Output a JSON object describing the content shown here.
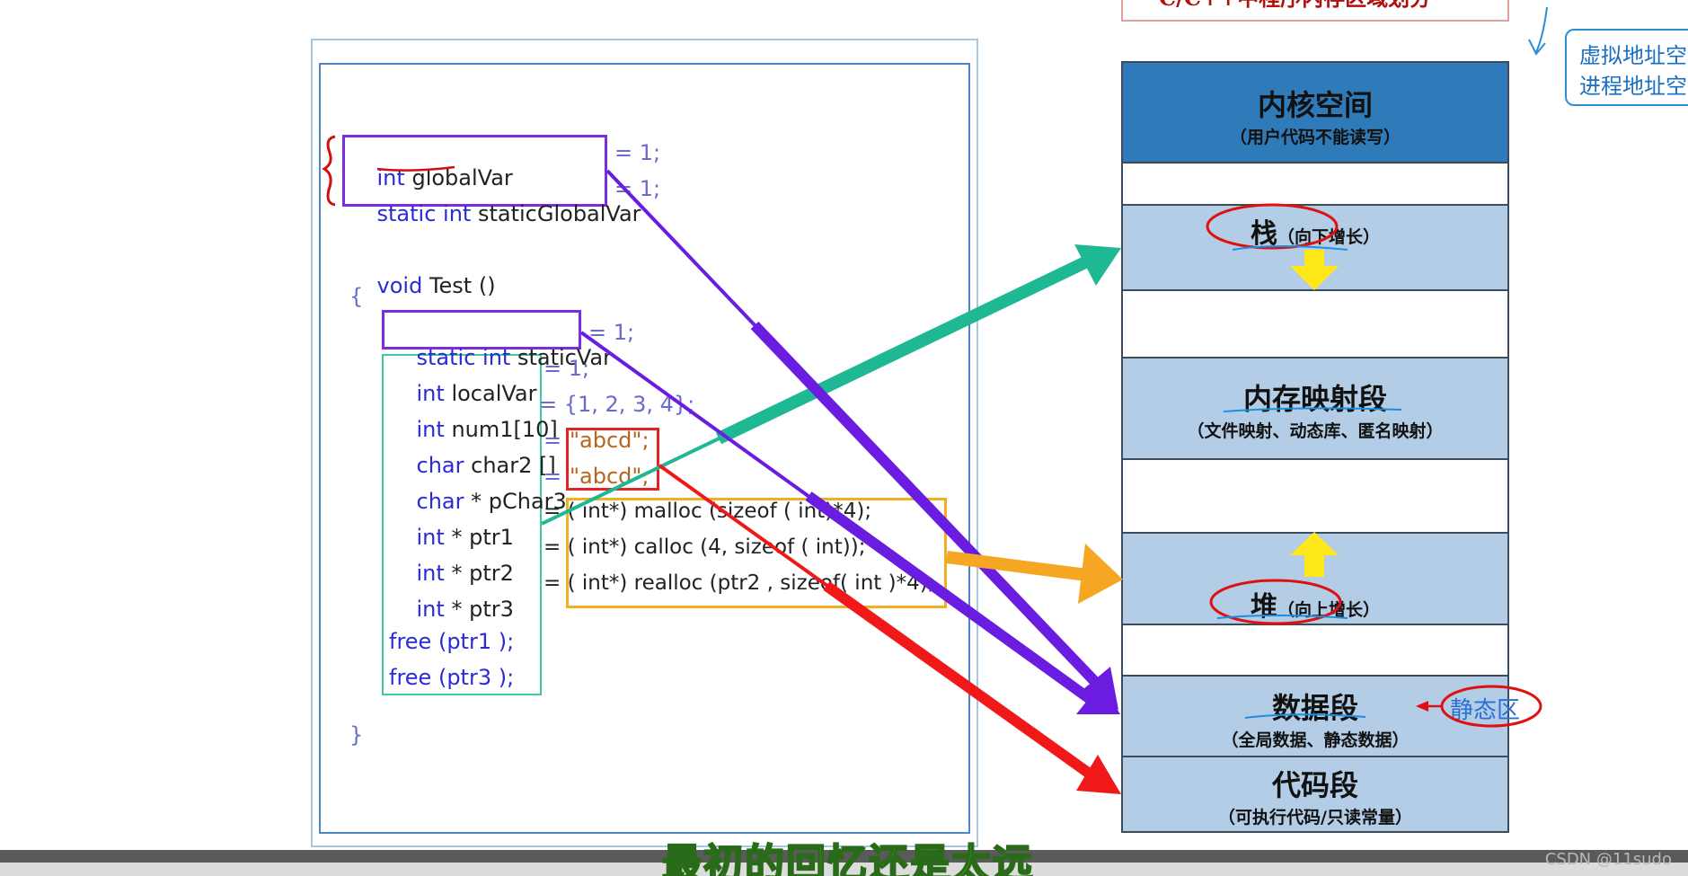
{
  "diagram": {
    "top_title": "C/C++中程序内存区域划分",
    "side_note_lines": [
      "虚拟地址空",
      "进程地址空"
    ],
    "code": {
      "line1": {
        "kw": "int",
        "name": "globalVar",
        "rest": "= 1;"
      },
      "line2": {
        "kw": "static int",
        "name": "staticGlobalVar",
        "rest": "= 1;"
      },
      "line3": {
        "kw": "void",
        "name": "Test ()"
      },
      "open_brace": "{",
      "line4": {
        "kw": "static int",
        "name": "staticVar",
        "rest": "= 1;"
      },
      "line5": {
        "kw": "int",
        "name": "localVar",
        "rest": "= 1;"
      },
      "line6": {
        "kw": "int",
        "name": "num1[10]",
        "rest": "= {1, 2, 3, 4};"
      },
      "line7": {
        "kw": "char",
        "name": "char2 []",
        "eq": "=",
        "str": "\"abcd\";"
      },
      "line8": {
        "kw": "char",
        "name": "* pChar3",
        "eq": "=",
        "str": "\"abcd\";"
      },
      "line9": {
        "kw": "int",
        "name": "* ptr1",
        "rest": "= ( int*) malloc (sizeof ( int)*4);"
      },
      "line10": {
        "kw": "int",
        "name": "* ptr2",
        "rest": "= ( int*) calloc (4, sizeof ( int));"
      },
      "line11": {
        "kw": "int",
        "name": "* ptr3",
        "rest": "= ( int*) realloc (ptr2 , sizeof( int )*4);"
      },
      "line12": "free (ptr1 );",
      "line13": "free (ptr3 );",
      "close_brace": "}"
    },
    "segments": {
      "kernel": {
        "title": "内核空间",
        "sub": "（用户代码不能读写）"
      },
      "stack": {
        "title": "栈",
        "sub": "（向下增长）"
      },
      "mmap": {
        "title": "内存映射段",
        "sub": "（文件映射、动态库、匿名映射）"
      },
      "heap": {
        "title": "堆",
        "sub": "（向上增长）"
      },
      "data": {
        "title": "数据段",
        "sub": "（全局数据、静态数据）"
      },
      "code": {
        "title": "代码段",
        "sub": "（可执行代码/只读常量）"
      }
    },
    "static_area_label": "静态区",
    "colors": {
      "kernel_fill": "#2f7ab8",
      "segment_fill": "#b3cde6",
      "purple_arrow": "#6a1de0",
      "teal_arrow": "#1fb894",
      "orange_arrow": "#f5a623",
      "red_arrow": "#f01818",
      "yellow_arrow": "#ffe81a"
    }
  },
  "subtitle": "最初的回忆还是太远",
  "watermark": "CSDN @11sudo"
}
